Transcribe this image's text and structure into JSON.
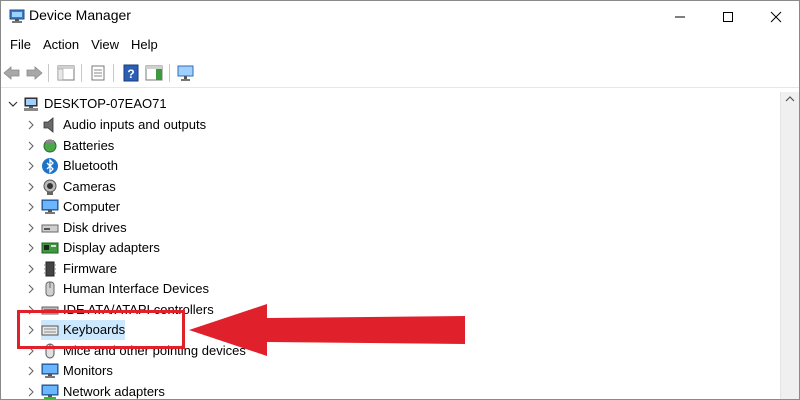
{
  "window": {
    "title": "Device Manager"
  },
  "menu": [
    "File",
    "Action",
    "View",
    "Help"
  ],
  "tree": {
    "root": "DESKTOP-07EAO71",
    "items": [
      "Audio inputs and outputs",
      "Batteries",
      "Bluetooth",
      "Cameras",
      "Computer",
      "Disk drives",
      "Display adapters",
      "Firmware",
      "Human Interface Devices",
      "IDE ATA/ATAPI controllers",
      "Keyboards",
      "Mice and other pointing devices",
      "Monitors",
      "Network adapters"
    ],
    "selected": "Keyboards"
  },
  "colors": {
    "annotation": "#e0202a",
    "selection": "#cce8ff",
    "accent": "#1e73c8"
  }
}
